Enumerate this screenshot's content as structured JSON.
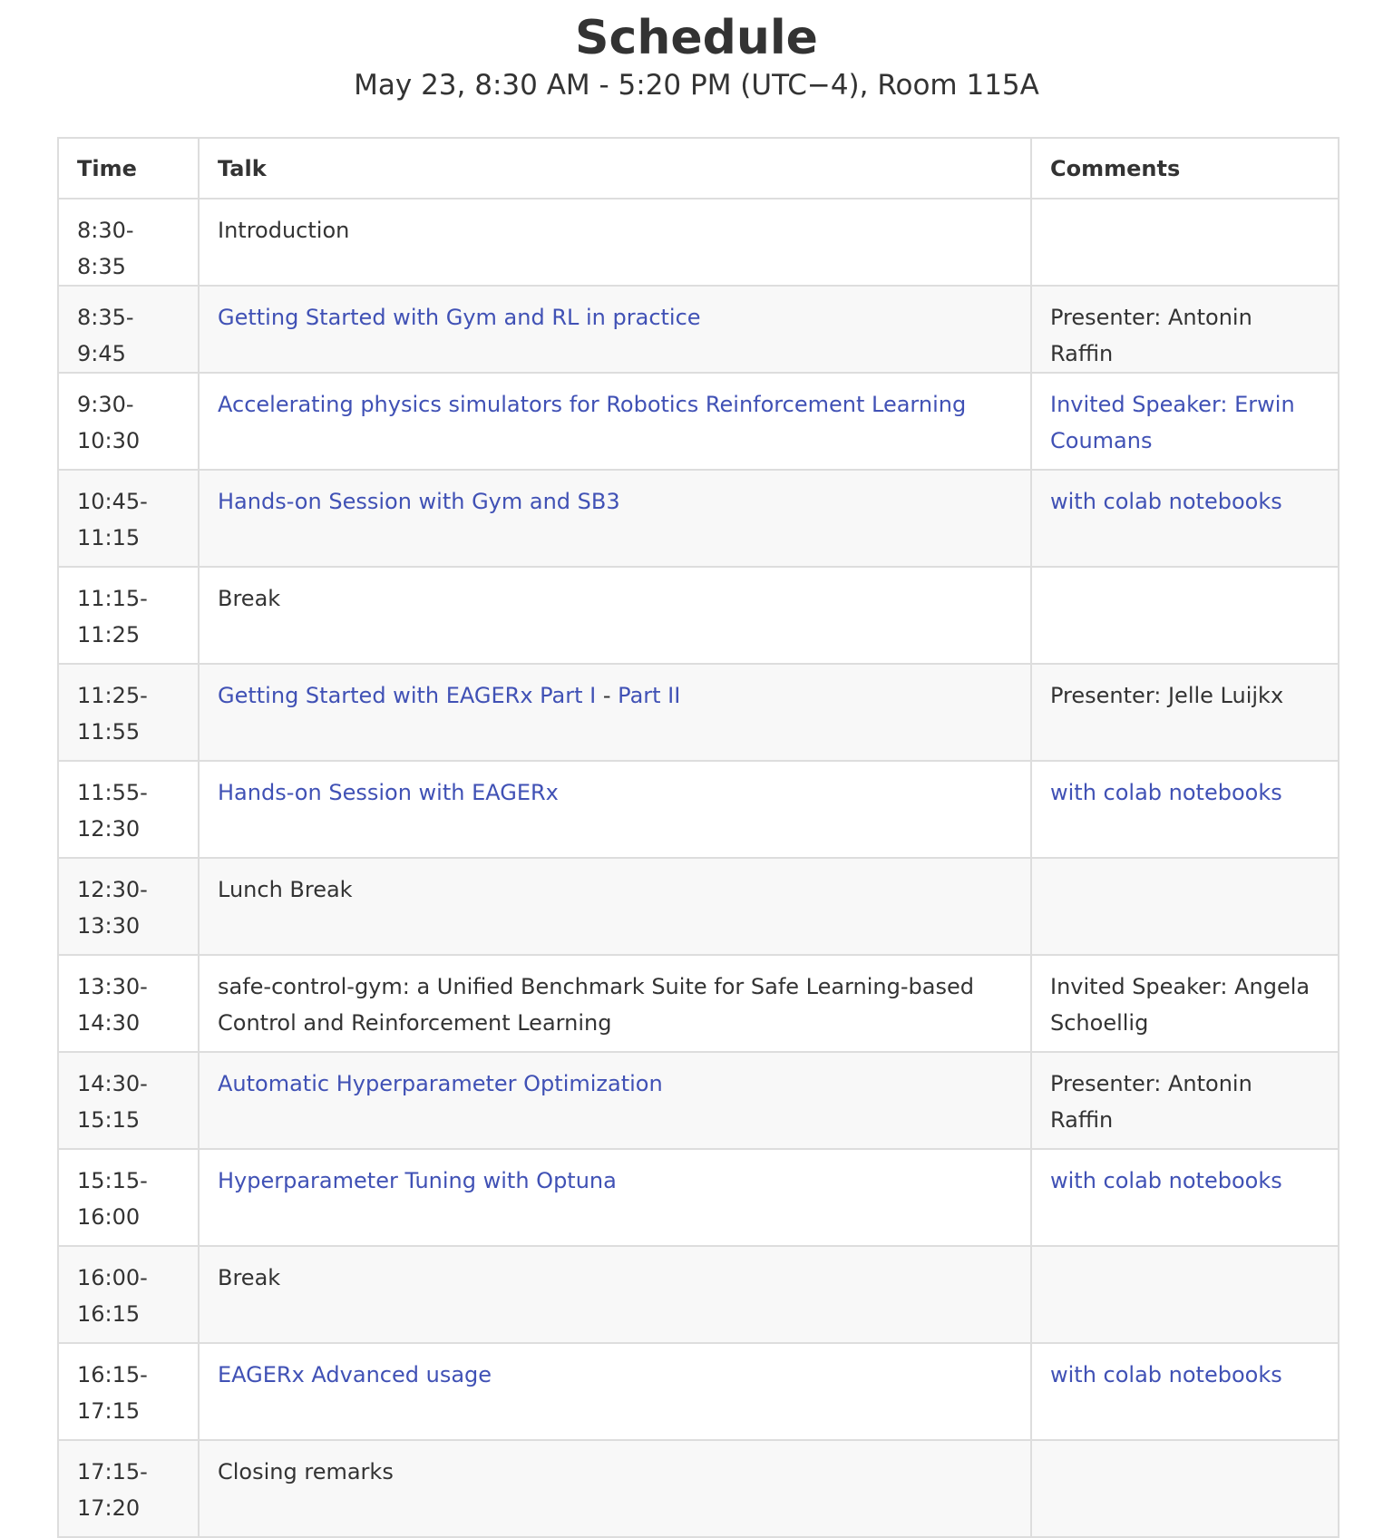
{
  "header": {
    "title": "Schedule",
    "subtitle": "May 23, 8:30 AM - 5:20 PM (UTC−4), Room 115A"
  },
  "colors": {
    "link": "#4051b5",
    "text": "#333333",
    "border": "#dddddd",
    "stripe": "#f8f8f8"
  },
  "table": {
    "headers": [
      "Time",
      "Talk",
      "Comments"
    ],
    "rows": [
      {
        "time": "8:30-8:35",
        "talk": "Introduction",
        "talk_link": false,
        "comment": "",
        "comment_link": false
      },
      {
        "time": "8:35-9:45",
        "talk": "Getting Started with Gym and RL in practice",
        "talk_link": true,
        "comment": "Presenter: Antonin Raffin",
        "comment_link": false
      },
      {
        "time": "9:30-10:30",
        "talk": "Accelerating physics simulators for Robotics Reinforcement Learning",
        "talk_link": true,
        "comment": "Invited Speaker: Erwin Coumans",
        "comment_link": true
      },
      {
        "time": "10:45-11:15",
        "talk": "Hands-on Session with Gym and SB3",
        "talk_link": true,
        "comment": "with colab notebooks",
        "comment_link": true
      },
      {
        "time": "11:15-11:25",
        "talk": "Break",
        "talk_link": false,
        "comment": "",
        "comment_link": false
      },
      {
        "time": "11:25-11:55",
        "talk": "Getting Started with EAGERx Part I",
        "talk_sep": " - ",
        "talk_extra": "Part II",
        "talk_link": true,
        "comment": "Presenter: Jelle Luijkx",
        "comment_link": false
      },
      {
        "time": "11:55-12:30",
        "talk": "Hands-on Session with EAGERx",
        "talk_link": true,
        "comment": "with colab notebooks",
        "comment_link": true
      },
      {
        "time": "12:30-13:30",
        "talk": "Lunch Break",
        "talk_link": false,
        "comment": "",
        "comment_link": false
      },
      {
        "time": "13:30-14:30",
        "talk": "safe-control-gym: a Unified Benchmark Suite for Safe Learning-based Control and Reinforcement Learning",
        "talk_link": false,
        "comment": "Invited Speaker: Angela Schoellig",
        "comment_link": false
      },
      {
        "time": "14:30-15:15",
        "talk": "Automatic Hyperparameter Optimization",
        "talk_link": true,
        "comment": "Presenter: Antonin Raffin",
        "comment_link": false
      },
      {
        "time": "15:15-16:00",
        "talk": "Hyperparameter Tuning with Optuna",
        "talk_link": true,
        "comment": "with colab notebooks",
        "comment_link": true
      },
      {
        "time": "16:00-16:15",
        "talk": "Break",
        "talk_link": false,
        "comment": "",
        "comment_link": false
      },
      {
        "time": "16:15-17:15",
        "talk": "EAGERx Advanced usage",
        "talk_link": true,
        "comment": "with colab notebooks",
        "comment_link": true
      },
      {
        "time": "17:15-17:20",
        "talk": "Closing remarks",
        "talk_link": false,
        "comment": "",
        "comment_link": false
      }
    ]
  }
}
